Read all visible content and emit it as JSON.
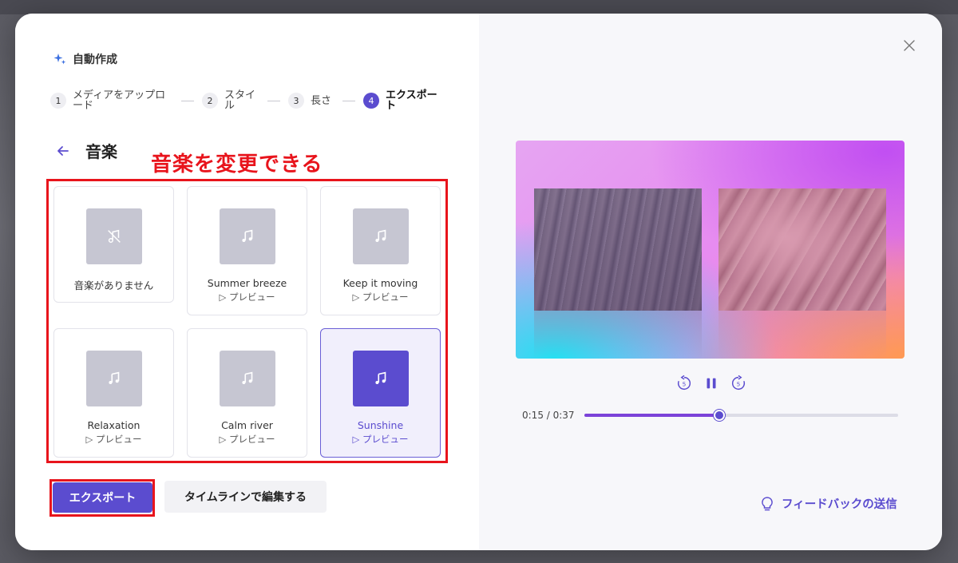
{
  "dialog": {
    "title": "自動作成",
    "steps": [
      {
        "num": "1",
        "label": "メディアをアップロード"
      },
      {
        "num": "2",
        "label": "スタイル"
      },
      {
        "num": "3",
        "label": "長さ"
      },
      {
        "num": "4",
        "label": "エクスポート"
      }
    ],
    "section_title": "音楽",
    "annotation": "音楽を変更できる",
    "music": [
      {
        "name": "音楽がありません",
        "preview": "",
        "icon": "no-music-icon"
      },
      {
        "name": "Summer breeze",
        "preview": "▷ プレビュー",
        "icon": "music-note-icon"
      },
      {
        "name": "Keep it moving",
        "preview": "▷ プレビュー",
        "icon": "music-note-icon"
      },
      {
        "name": "Relaxation",
        "preview": "▷ プレビュー",
        "icon": "music-note-icon"
      },
      {
        "name": "Calm river",
        "preview": "▷ プレビュー",
        "icon": "music-note-icon"
      },
      {
        "name": "Sunshine",
        "preview": "▷ プレビュー",
        "icon": "music-note-icon",
        "selected": true
      }
    ],
    "export_label": "エクスポート",
    "timeline_label": "タイムラインで編集する"
  },
  "player": {
    "time": "0:15 / 0:37",
    "progress": 0.43
  },
  "feedback_label": "フィードバックの送信",
  "colors": {
    "accent": "#5b4ccf",
    "annotation_red": "#e8141c"
  }
}
